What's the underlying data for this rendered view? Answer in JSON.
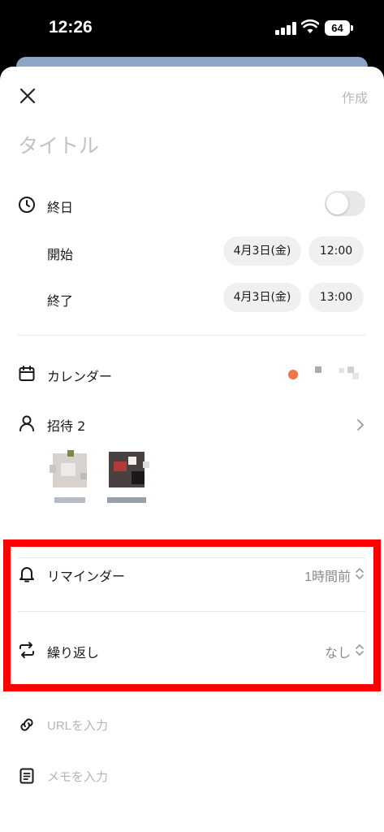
{
  "status": {
    "time": "12:26",
    "battery": "64"
  },
  "header": {
    "create_label": "作成",
    "title_placeholder": "タイトル"
  },
  "allday": {
    "label": "終日",
    "enabled": false
  },
  "start": {
    "label": "開始",
    "date": "4月3日(金)",
    "time": "12:00"
  },
  "end": {
    "label": "終了",
    "date": "4月3日(金)",
    "time": "13:00"
  },
  "calendar": {
    "label": "カレンダー",
    "color": "#f0774b"
  },
  "invite": {
    "label": "招待 2",
    "count": 2
  },
  "reminder": {
    "label": "リマインダー",
    "value": "1時間前"
  },
  "repeat": {
    "label": "繰り返し",
    "value": "なし"
  },
  "url": {
    "placeholder": "URLを入力"
  },
  "memo": {
    "placeholder": "メモを入力"
  },
  "colors": {
    "highlight": "#ff0000",
    "accent_dot": "#f0774b"
  }
}
